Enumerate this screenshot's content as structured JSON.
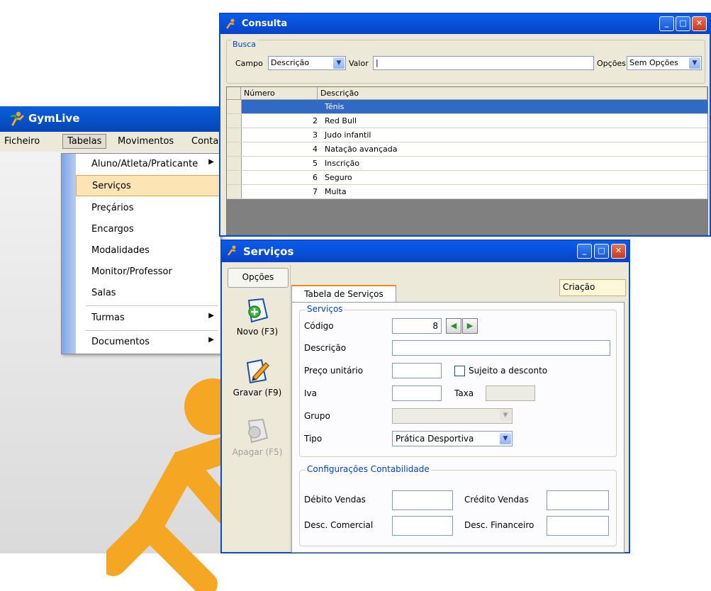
{
  "app": {
    "title": "GymLive",
    "menu": [
      "Ficheiro",
      "Tabelas",
      "Movimentos",
      "Conta"
    ]
  },
  "tabelas_menu": {
    "items": [
      {
        "label": "Aluno/Atleta/Praticante",
        "submenu": true
      },
      {
        "label": "Serviços",
        "submenu": false,
        "selected": true
      },
      {
        "label": "Preçários",
        "submenu": false
      },
      {
        "label": "Encargos",
        "submenu": false
      },
      {
        "label": "Modalidades",
        "submenu": false
      },
      {
        "label": "Monitor/Professor",
        "submenu": false
      },
      {
        "label": "Salas",
        "submenu": false
      },
      {
        "label": "Turmas",
        "submenu": true
      },
      {
        "label": "Documentos",
        "submenu": true
      }
    ]
  },
  "consulta": {
    "title": "Consulta",
    "busca_legend": "Busca",
    "campo_label": "Campo",
    "campo_value": "Descrição",
    "valor_label": "Valor",
    "valor_value": "",
    "opcoes_label": "Opções",
    "opcoes_value": "Sem Opções",
    "columns": [
      "Número",
      "Descrição"
    ],
    "rows": [
      {
        "numero": "",
        "descricao": "Ténis",
        "selected": true
      },
      {
        "numero": "2",
        "descricao": "Red Bull"
      },
      {
        "numero": "3",
        "descricao": "Judo infantil"
      },
      {
        "numero": "4",
        "descricao": "Natação avançada"
      },
      {
        "numero": "5",
        "descricao": "Inscrição"
      },
      {
        "numero": "6",
        "descricao": "Seguro"
      },
      {
        "numero": "7",
        "descricao": "Multa"
      }
    ]
  },
  "servicos": {
    "title": "Serviços",
    "opcoes_button": "Opções",
    "actions": [
      {
        "label": "Novo (F3)",
        "enabled": true
      },
      {
        "label": "Gravar (F9)",
        "enabled": true
      },
      {
        "label": "Apagar (F5)",
        "enabled": false
      }
    ],
    "tab_label": "Tabela de Serviços",
    "mode_badge": "Criação",
    "group_servicos": "Serviços",
    "codigo_label": "Código",
    "codigo_value": "8",
    "descricao_label": "Descrição",
    "descricao_value": "",
    "preco_label": "Preço unitário",
    "preco_value": "",
    "desconto_label": "Sujeito a desconto",
    "iva_label": "Iva",
    "iva_value": "",
    "taxa_label": "Taxa",
    "taxa_value": "",
    "grupo_label": "Grupo",
    "grupo_value": "",
    "tipo_label": "Tipo",
    "tipo_value": "Prática Desportiva",
    "group_contab": "Configurações Contabilidade",
    "debito_label": "Débito Vendas",
    "credito_label": "Crédito Vendas",
    "desc_comercial_label": "Desc. Comercial",
    "desc_financeiro_label": "Desc. Financeiro"
  },
  "colors": {
    "titlebar_blue": "#0a5ce8",
    "selection_blue": "#316ac5",
    "menu_highlight": "#fde4b4",
    "brand_orange": "#f5a623"
  }
}
